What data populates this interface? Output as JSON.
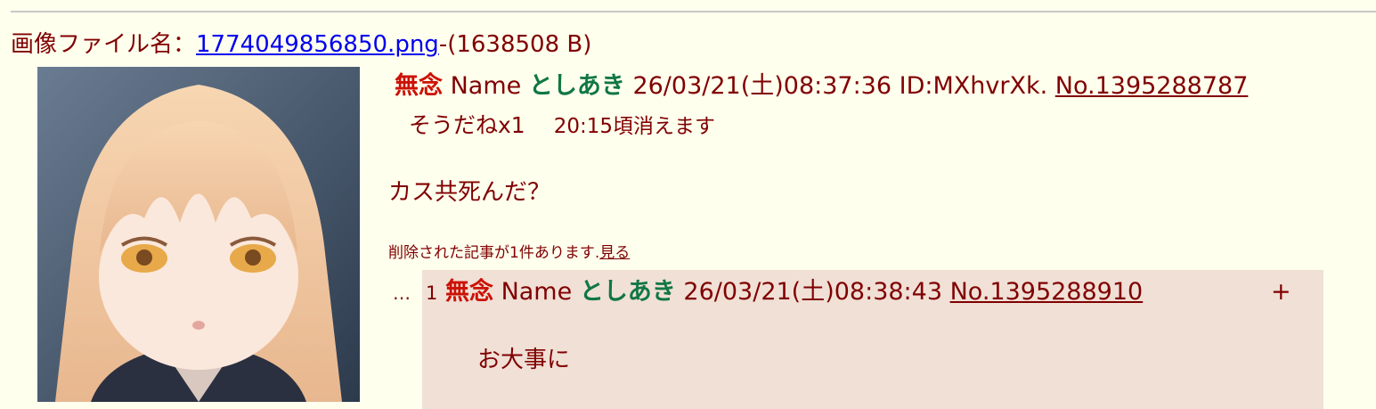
{
  "file": {
    "label": "画像ファイル名：",
    "filename": "1774049856850.png",
    "size": "-(1638508 B)"
  },
  "post": {
    "subject": "無念",
    "name_label": "Name",
    "poster": "としあき",
    "datetime": "26/03/21(土)08:37:36 ID:MXhvrXk.",
    "post_no": "No.1395288787",
    "sodane": "そうだねx1",
    "expire": "20:15頃消えます",
    "comment": "カス共死んだ？"
  },
  "deleted": {
    "notice": "削除された記事が1件あります.",
    "view_link": "見る"
  },
  "reply": {
    "dots": "…",
    "index": "1",
    "subject": "無念",
    "name_label": "Name",
    "poster": "としあき",
    "datetime": "26/03/21(土)08:38:43",
    "post_no": "No.1395288910",
    "plus": "+",
    "comment": "お大事に"
  },
  "colors": {
    "background": "#ffffee",
    "text": "#800000",
    "subject": "#cc1105",
    "poster": "#117743",
    "reply_bg": "#f0e0d6",
    "link": "#0000ee"
  }
}
